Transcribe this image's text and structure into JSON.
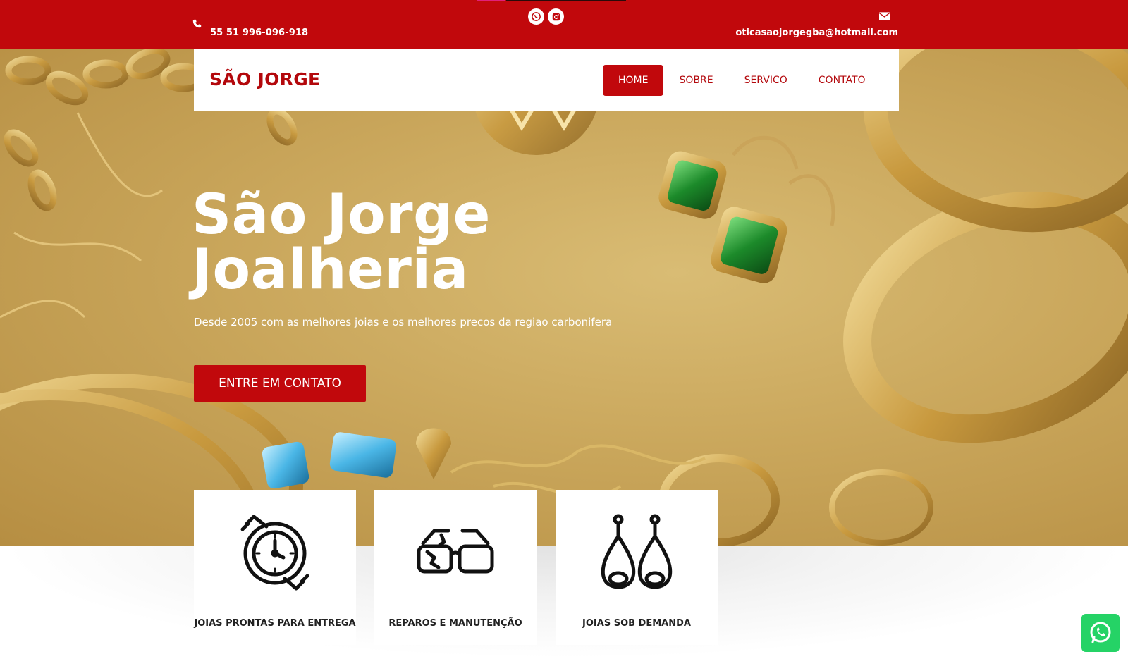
{
  "topbar": {
    "phone": "55 51 996-096-918",
    "email": "oticasaojorgegba@hotmail.com",
    "social_icons": [
      "whatsapp-icon",
      "instagram-icon"
    ],
    "phone_icon": "phone-icon",
    "mail_icon": "envelope-icon",
    "bg_color": "#c1080c"
  },
  "nav": {
    "brand": "SÃO JORGE",
    "links": [
      {
        "label": "HOME",
        "active": true
      },
      {
        "label": "SOBRE",
        "active": false
      },
      {
        "label": "SERVICO",
        "active": false
      },
      {
        "label": "CONTATO",
        "active": false
      }
    ]
  },
  "hero": {
    "title_line1": "São Jorge",
    "title_line2": "Joalheria",
    "subtitle": "Desde 2005 com as melhores joias e os melhores precos da regiao carbonifera",
    "cta": "ENTRE EM CONTATO"
  },
  "services": [
    {
      "label": "JOIAS PRONTAS PARA ENTREGA",
      "icon": "watch-icon"
    },
    {
      "label": "REPAROS E MANUTENÇÃO",
      "icon": "broken-glasses-icon"
    },
    {
      "label": "JOIAS SOB DEMANDA",
      "icon": "earrings-icon"
    }
  ],
  "floating": {
    "icon": "whatsapp-icon",
    "color": "#25d366"
  },
  "colors": {
    "brand_red": "#c1080c",
    "gold": "#caa75c"
  }
}
